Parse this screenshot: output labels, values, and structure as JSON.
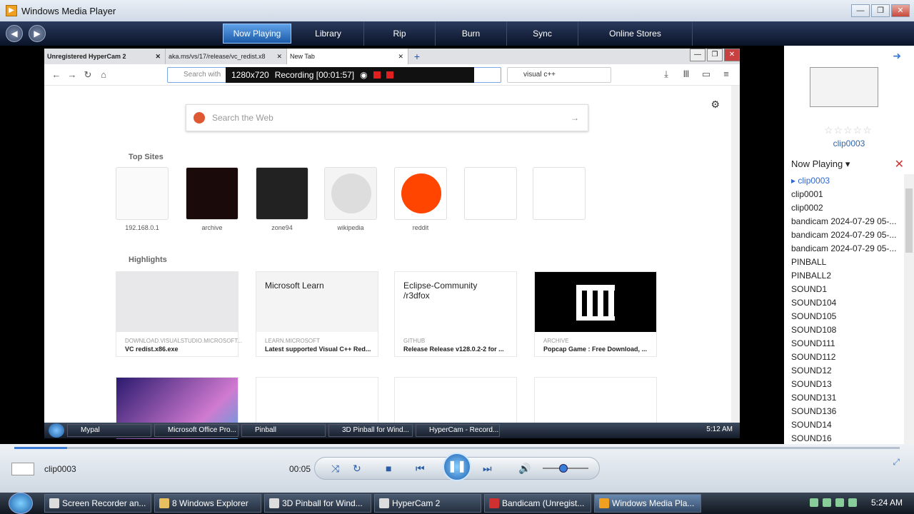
{
  "window": {
    "title": "Windows Media Player",
    "controls": [
      "—",
      "❐",
      "✕"
    ]
  },
  "nav": {
    "back_icon": "back-arrow-icon",
    "tabs": [
      "Now Playing",
      "Library",
      "Rip",
      "Burn",
      "Sync",
      "Online Stores"
    ]
  },
  "firefox": {
    "tabs": [
      "Unregistered HyperCam 2",
      "aka.ms/vs/17/release/vc_redist.x8",
      "New Tab"
    ],
    "url_placeholder": "Search with",
    "search_value": "visual c++",
    "web_search_placeholder": "Search the Web",
    "top_sites_label": "Top Sites",
    "top_sites": [
      "192.168.0.1",
      "archive",
      "zone94",
      "wikipedia",
      "reddit",
      "",
      ""
    ],
    "highlights_label": "Highlights",
    "highlights": [
      {
        "source": "DOWNLOAD.VISUALSTUDIO.MICROSOFT...",
        "title": "VC redist.x86.exe",
        "image_text": ""
      },
      {
        "source": "LEARN.MICROSOFT",
        "title": "Latest supported Visual C++ Red...",
        "image_text": "Microsoft Learn"
      },
      {
        "source": "GITHUB",
        "title": "Release Release v128.0.2-2 for ...",
        "image_text": "Eclipse-Community /r3dfox"
      },
      {
        "source": "ARCHIVE",
        "title": "Popcap Game : Free Download, ...",
        "image_text": ""
      }
    ]
  },
  "hypercam": {
    "resolution": "1280x720",
    "recording": "Recording [00:01:57]"
  },
  "inner_taskbar": {
    "items": [
      "Mypal",
      "Microsoft Office Pro...",
      "Pinball",
      "3D Pinball for Wind...",
      "HyperCam - Record..."
    ],
    "clock": "5:12 AM"
  },
  "now_playing": {
    "clip": "clip0003",
    "header": "Now Playing",
    "items": [
      "clip0003",
      "clip0001",
      "clip0002",
      "bandicam 2024-07-29 05-...",
      "bandicam 2024-07-29 05-...",
      "bandicam 2024-07-29 05-...",
      "PINBALL",
      "PINBALL2",
      "SOUND1",
      "SOUND104",
      "SOUND105",
      "SOUND108",
      "SOUND111",
      "SOUND112",
      "SOUND12",
      "SOUND13",
      "SOUND131",
      "SOUND136",
      "SOUND14",
      "SOUND16"
    ]
  },
  "playback": {
    "title": "clip0003",
    "time": "00:05",
    "progress": 0.06,
    "volume": 0.45
  },
  "taskbar": {
    "items": [
      "Screen Recorder an...",
      "8 Windows Explorer",
      "3D Pinball for Wind...",
      "HyperCam 2",
      "Bandicam (Unregist...",
      "Windows Media Pla..."
    ],
    "clock": "5:24 AM"
  }
}
